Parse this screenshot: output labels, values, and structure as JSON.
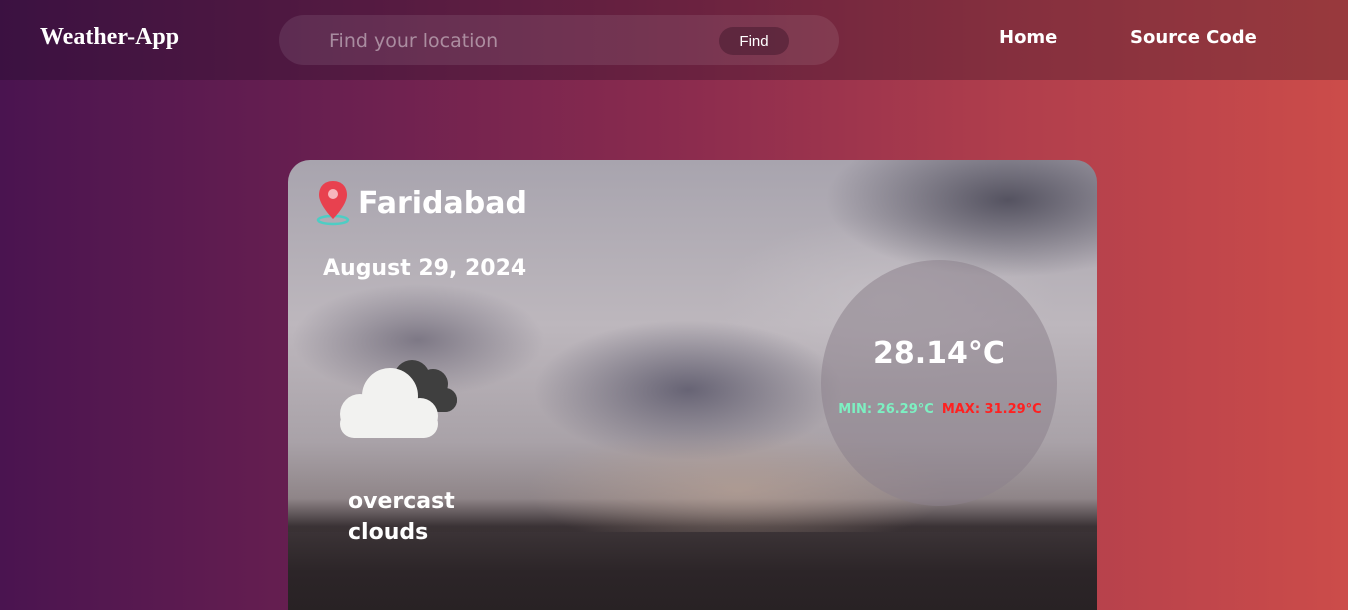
{
  "nav": {
    "brand": "Weather-App",
    "search_placeholder": "Find your location",
    "find_label": "Find",
    "home_label": "Home",
    "source_label": "Source Code"
  },
  "weather": {
    "city": "Faridabad",
    "date": "August 29, 2024",
    "temp": "28.14°C",
    "min": "MIN: 26.29°C",
    "max": "MAX: 31.29°C",
    "description": "overcast clouds",
    "condition_icon": "broken-clouds-icon"
  },
  "colors": {
    "min_color": "#7df0c2",
    "max_color": "#ff2020",
    "pin_color": "#e8414f"
  }
}
